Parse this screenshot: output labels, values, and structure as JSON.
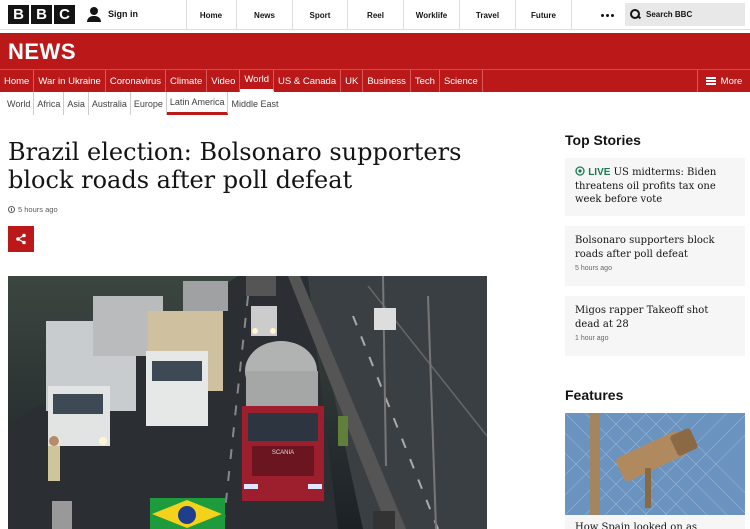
{
  "topbar": {
    "logo_letters": [
      "B",
      "B",
      "C"
    ],
    "signin_label": "Sign in",
    "nav": [
      "Home",
      "News",
      "Sport",
      "Reel",
      "Worklife",
      "Travel",
      "Future"
    ],
    "search_placeholder": "Search BBC"
  },
  "brand": {
    "title": "NEWS",
    "color": "#bb1919"
  },
  "section_nav": {
    "items": [
      "Home",
      "War in Ukraine",
      "Coronavirus",
      "Climate",
      "Video",
      "World",
      "US & Canada",
      "UK",
      "Business",
      "Tech",
      "Science"
    ],
    "active": "World",
    "more_label": "More"
  },
  "sub_nav": {
    "items": [
      "World",
      "Africa",
      "Asia",
      "Australia",
      "Europe",
      "Latin America",
      "Middle East"
    ],
    "active": "Latin America"
  },
  "article": {
    "headline": "Brazil election: Bolsonaro supporters block roads after poll defeat",
    "timestamp": "5 hours ago"
  },
  "sidebar": {
    "top_stories_heading": "Top Stories",
    "stories": [
      {
        "live_label": "LIVE",
        "title": "US midterms: Biden threatens oil profits tax one week before vote",
        "time": ""
      },
      {
        "live_label": "",
        "title": "Bolsonaro supporters block roads after poll defeat",
        "time": "5 hours ago"
      },
      {
        "live_label": "",
        "title": "Migos rapper Takeoff shot dead at 28",
        "time": "1 hour ago"
      }
    ],
    "features_heading": "Features",
    "feature_title": "How Spain looked on as"
  },
  "truck_brand": "SCANIA"
}
